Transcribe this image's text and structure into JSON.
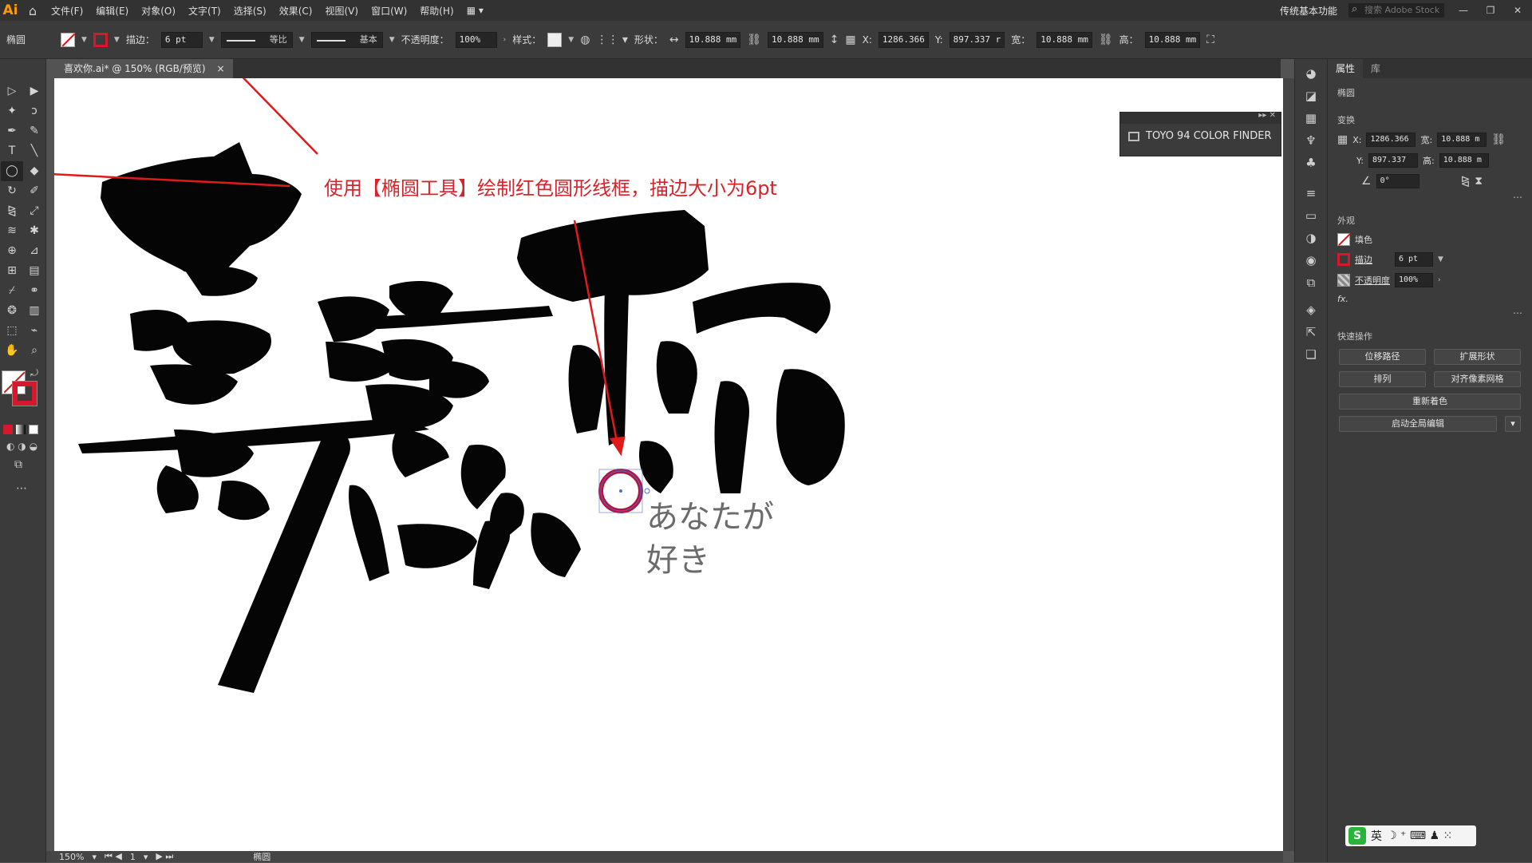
{
  "menubar": {
    "logo": "Ai",
    "items": [
      "文件(F)",
      "编辑(E)",
      "对象(O)",
      "文字(T)",
      "选择(S)",
      "效果(C)",
      "视图(V)",
      "窗口(W)",
      "帮助(H)"
    ],
    "workspace": "传统基本功能",
    "search_placeholder": "搜索 Adobe Stock"
  },
  "controlbar": {
    "object_type": "椭圆",
    "stroke_label": "描边：",
    "stroke_weight": "6 pt",
    "profile_label": "等比",
    "brush_label": "基本",
    "opacity_label": "不透明度：",
    "opacity_value": "100%",
    "style_label": "样式：",
    "shape_label": "形状：",
    "shape_w": "10.888 mm",
    "shape_h": "10.888 mm",
    "x_label": "X:",
    "x_value": "1286.366",
    "y_label": "Y:",
    "y_value": "897.337 r",
    "w_label": "宽：",
    "w_value": "10.888 mm",
    "h_label": "高：",
    "h_value": "10.888 mm"
  },
  "document": {
    "tab_title": "喜欢你.ai* @ 150% (RGB/预览)",
    "close": "×"
  },
  "canvas": {
    "annotation": "使用【椭圆工具】绘制红色圆形线框，描边大小为6pt",
    "jp_line1": "あなたが",
    "jp_line2": "好き"
  },
  "toyo_panel": {
    "title": "TOYO 94 COLOR FINDER"
  },
  "properties": {
    "tabs": [
      "属性",
      "库"
    ],
    "object": "椭圆",
    "transform_title": "变换",
    "x_label": "X:",
    "x": "1286.366",
    "y_label": "Y:",
    "y": "897.337",
    "w_label": "宽:",
    "w": "10.888 m",
    "h_label": "高:",
    "h": "10.888 m",
    "angle": "0°",
    "appearance_title": "外观",
    "fill_label": "填色",
    "stroke_label": "描边",
    "stroke_value": "6 pt",
    "opacity_label": "不透明度",
    "opacity_value": "100%",
    "fx": "fx.",
    "quick_title": "快速操作",
    "btn_offset": "位移路径",
    "btn_expand": "扩展形状",
    "btn_arrange": "排列",
    "btn_align_pixel": "对齐像素网格",
    "btn_recolor": "重新着色",
    "btn_global_edit": "启动全局编辑"
  },
  "statusbar": {
    "zoom": "150%",
    "page": "1",
    "tool": "椭圆"
  },
  "ime": {
    "logo": "S",
    "mode": "英"
  },
  "colors": {
    "accent_red": "#d3192b",
    "annotation_red": "#d9232a"
  }
}
